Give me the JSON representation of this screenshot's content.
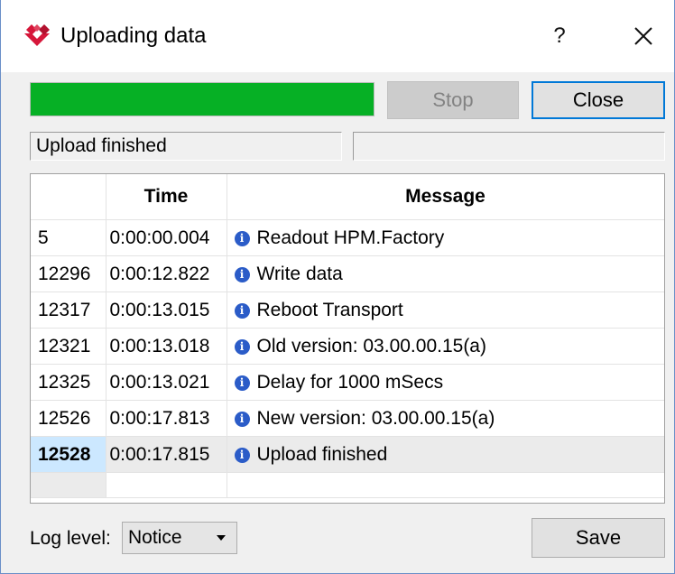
{
  "window": {
    "title": "Uploading data",
    "help_label": "?",
    "icons": {
      "app": "app-logo-icon",
      "close": "close-icon",
      "info": "info-icon",
      "dropdown": "chevron-down-icon"
    }
  },
  "progress": {
    "value_percent": 100,
    "color": "#06b025"
  },
  "buttons": {
    "stop_label": "Stop",
    "close_label": "Close",
    "save_label": "Save"
  },
  "status": {
    "left_text": "Upload finished",
    "right_text": ""
  },
  "log": {
    "headers": {
      "id": "",
      "time": "Time",
      "message": "Message"
    },
    "rows": [
      {
        "id": "5",
        "time": "0:00:00.004",
        "message": "Readout HPM.Factory"
      },
      {
        "id": "12296",
        "time": "0:00:12.822",
        "message": "Write data"
      },
      {
        "id": "12317",
        "time": "0:00:13.015",
        "message": "Reboot Transport"
      },
      {
        "id": "12321",
        "time": "0:00:13.018",
        "message": "Old version: 03.00.00.15(a)"
      },
      {
        "id": "12325",
        "time": "0:00:13.021",
        "message": "Delay for 1000 mSecs"
      },
      {
        "id": "12526",
        "time": "0:00:17.813",
        "message": "New version: 03.00.00.15(a)"
      },
      {
        "id": "12528",
        "time": "0:00:17.815",
        "message": "Upload finished"
      }
    ],
    "selected_row": 6
  },
  "footer": {
    "log_level_label": "Log level:",
    "log_level_value": "Notice"
  },
  "colors": {
    "accent": "#0078d7",
    "progress": "#06b025",
    "info": "#2b5cc8",
    "selection": "#cce8ff"
  }
}
